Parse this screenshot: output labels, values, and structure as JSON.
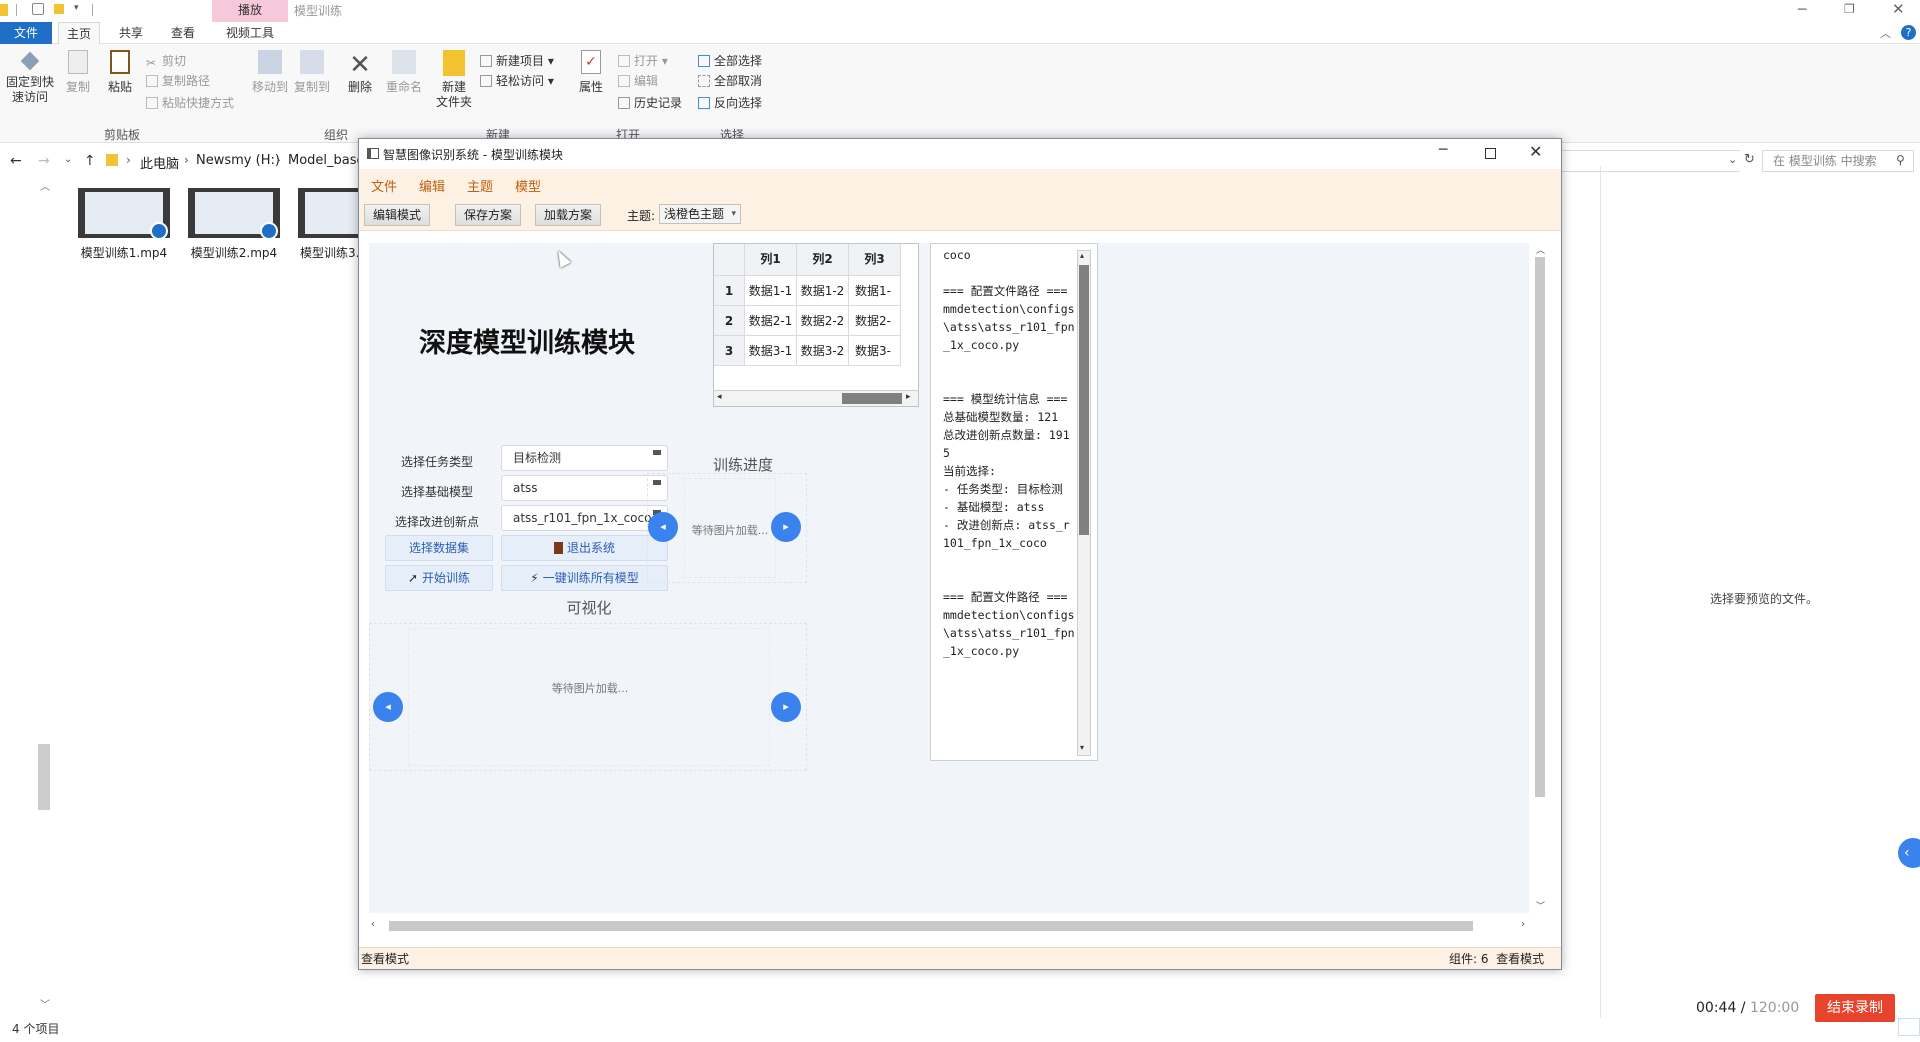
{
  "explorer": {
    "tab_context": "播放",
    "window_title": "模型训练",
    "tabs": [
      "文件",
      "主页",
      "共享",
      "查看",
      "视频工具"
    ],
    "ribbon": {
      "pin_label": "固定到快\n速访问",
      "copy_label": "复制",
      "paste_label": "粘贴",
      "cut_label": "剪切",
      "copy_path_label": "复制路径",
      "paste_shortcut_label": "粘贴快捷方式",
      "group_clipboard": "剪贴板",
      "move_to_label": "移动到",
      "copy_to_label": "复制到",
      "delete_label": "删除",
      "rename_label": "重命名",
      "group_organize": "组织",
      "new_folder_label": "新建\n文件夹",
      "new_item_label": "新建项目",
      "easy_access_label": "轻松访问",
      "group_new": "新建",
      "properties_label": "属性",
      "open_label": "打开",
      "edit_label": "编辑",
      "history_label": "历史记录",
      "group_open": "打开",
      "select_all_label": "全部选择",
      "select_none_label": "全部取消",
      "invert_label": "反向选择",
      "group_select": "选择"
    },
    "breadcrumb": [
      "此电脑",
      "Newsmy (H:)",
      "Model_base"
    ],
    "search_placeholder": "在 模型训练 中搜索",
    "files": [
      "模型训练1.mp4",
      "模型训练2.mp4",
      "模型训练3."
    ],
    "preview_text": "选择要预览的文件。",
    "status_count": "4 个项目"
  },
  "recorder": {
    "elapsed": "00:44",
    "separator": " / ",
    "total": "120:00",
    "stop_label": "结束录制"
  },
  "app": {
    "title": "智慧图像识别系统 - 模型训练模块",
    "menu": [
      "文件",
      "编辑",
      "主题",
      "模型"
    ],
    "toolbar": {
      "edit_mode": "编辑模式",
      "save_plan": "保存方案",
      "load_plan": "加载方案",
      "theme_label": "主题:",
      "theme_value": "浅橙色主题"
    },
    "heading": "深度模型训练模块",
    "form": {
      "task_label": "选择任务类型",
      "task_value": "目标检测",
      "base_label": "选择基础模型",
      "base_value": "atss",
      "improve_label": "选择改进创新点",
      "improve_value": "atss_r101_fpn_1x_coco"
    },
    "buttons": {
      "select_dataset": "选择数据集",
      "exit": "退出系统",
      "start_train": "开始训练",
      "train_all": "一键训练所有模型"
    },
    "progress_title": "训练进度",
    "waiting": "等待图片加载...",
    "viz_title": "可视化",
    "table": {
      "columns": [
        "列1",
        "列2",
        "列3"
      ],
      "rows": [
        {
          "id": "1",
          "cells": [
            "数据1-1",
            "数据1-2",
            "数据1-"
          ]
        },
        {
          "id": "2",
          "cells": [
            "数据2-1",
            "数据2-2",
            "数据2-"
          ]
        },
        {
          "id": "3",
          "cells": [
            "数据3-1",
            "数据3-2",
            "数据3-"
          ]
        }
      ]
    },
    "log": "coco\n\n=== 配置文件路径 ===\nmmdetection\\configs\\atss\\atss_r101_fpn_1x_coco.py\n\n\n=== 模型统计信息 ===\n总基础模型数量: 121\n总改进创新点数量: 1915\n当前选择:\n- 任务类型: 目标检测\n- 基础模型: atss\n- 改进创新点: atss_r101_fpn_1x_coco\n\n\n=== 配置文件路径 ===\nmmdetection\\configs\\atss\\atss_r101_fpn_1x_coco.py",
    "status_left": "查看模式",
    "status_right": "组件: 6  查看模式"
  }
}
